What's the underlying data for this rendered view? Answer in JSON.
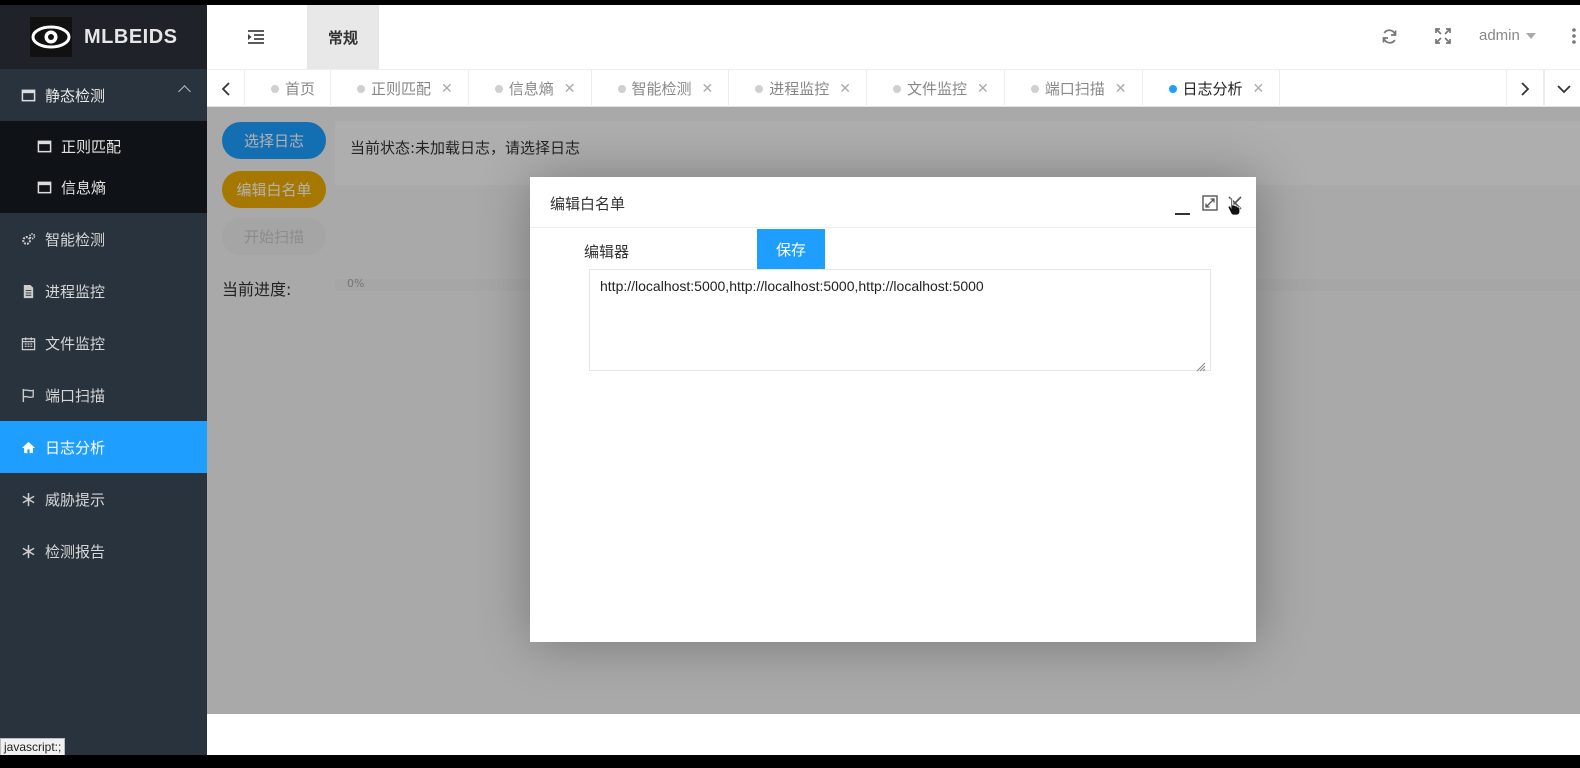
{
  "app": {
    "logo_text": "MLBEIDS"
  },
  "header": {
    "tab_label": "常规",
    "user_label": "admin"
  },
  "sidebar": {
    "group": {
      "label": "静态检测",
      "children": [
        {
          "label": "正则匹配"
        },
        {
          "label": "信息熵"
        }
      ]
    },
    "items": [
      {
        "label": "智能检测",
        "icon": "gears-icon"
      },
      {
        "label": "进程监控",
        "icon": "document-icon"
      },
      {
        "label": "文件监控",
        "icon": "calendar-icon"
      },
      {
        "label": "端口扫描",
        "icon": "flag-icon"
      },
      {
        "label": "日志分析",
        "icon": "home-icon",
        "active": true
      },
      {
        "label": "威胁提示",
        "icon": "snowflake-icon"
      },
      {
        "label": "检测报告",
        "icon": "snowflake-icon"
      }
    ]
  },
  "tabs": [
    {
      "label": "首页",
      "closable": false
    },
    {
      "label": "正则匹配",
      "closable": true
    },
    {
      "label": "信息熵",
      "closable": true
    },
    {
      "label": "智能检测",
      "closable": true
    },
    {
      "label": "进程监控",
      "closable": true
    },
    {
      "label": "文件监控",
      "closable": true
    },
    {
      "label": "端口扫描",
      "closable": true
    },
    {
      "label": "日志分析",
      "closable": true,
      "active": true
    }
  ],
  "content": {
    "select_log_label": "选择日志",
    "edit_whitelist_label": "编辑白名单",
    "start_scan_label": "开始扫描",
    "status_text": "当前状态:未加载日志，请选择日志",
    "progress_label": "当前进度:",
    "progress_value": "0%"
  },
  "modal": {
    "title": "编辑白名单",
    "editor_label": "编辑器",
    "save_label": "保存",
    "text_value": "http://localhost:5000,http://localhost:5000,http://localhost:5000"
  },
  "status_bar": {
    "text": "javascript:;"
  },
  "colors": {
    "accent": "#1e9fff",
    "warning": "#f0ad00",
    "sidebar_bg": "#28333e",
    "logo_bg": "#20222a"
  }
}
